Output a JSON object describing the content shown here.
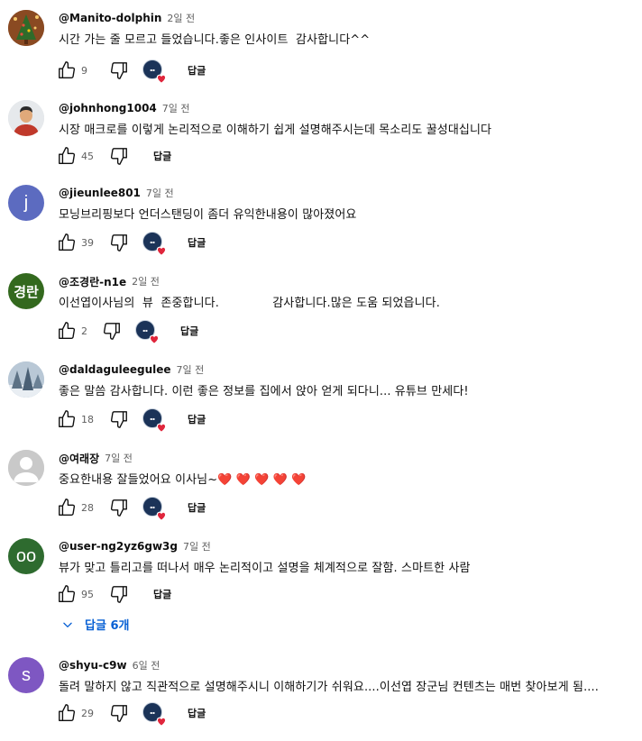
{
  "comments": [
    {
      "author": "@Manito-dolphin",
      "time": "2일 전",
      "text": "시간 가는 줄 모르고 들었습니다.좋은 인사이트  감사합니다^^",
      "likes": "9",
      "reply_label": "답글",
      "avatar_icon": "christmas-tree-photo",
      "creator_heart": true
    },
    {
      "author": "@johnhong1004",
      "time": "7일 전",
      "text": "시장 매크로를 이렇게 논리적으로 이해하기 쉽게 설명해주시는데 목소리도 꿀성대십니다",
      "likes": "45",
      "reply_label": "답글",
      "avatar_icon": "person-photo",
      "creator_heart": false
    },
    {
      "author": "@jieunlee801",
      "time": "7일 전",
      "text": "모닝브리핑보다 언더스탠딩이 좀더 유익한내용이 많아졌어요",
      "likes": "39",
      "reply_label": "답글",
      "avatar_letter": "j",
      "avatar_color": "#5c6bc0",
      "creator_heart": true
    },
    {
      "author": "@조경란-n1e",
      "time": "2일 전",
      "text": "이선엽이사님의  뷰  존중합니다.              감사합니다.많은 도움 되었읍니다.",
      "likes": "2",
      "reply_label": "답글",
      "avatar_letter": "경란",
      "avatar_color": "#33691e",
      "creator_heart": true
    },
    {
      "author": "@daldaguleegulee",
      "time": "7일 전",
      "text": "좋은 말씀 감사합니다. 이런 좋은 정보를 집에서 앉아 얻게 되다니... 유튜브 만세다!",
      "likes": "18",
      "reply_label": "답글",
      "avatar_icon": "winter-tree-photo",
      "creator_heart": true
    },
    {
      "author": "@여래장",
      "time": "7일 전",
      "text": "중요한내용 잘들었어요 이사님~",
      "hearts": "❤️ ❤️ ❤️ ❤️ ❤️",
      "likes": "28",
      "reply_label": "답글",
      "avatar_icon": "default-person-icon",
      "creator_heart": true
    },
    {
      "author": "@user-ng2yz6gw3g",
      "time": "7일 전",
      "text": "뷰가 맞고 틀리고를 떠나서 매우 논리적이고 설명을 체계적으로 잘함. 스마트한 사람",
      "likes": "95",
      "reply_label": "답글",
      "avatar_letter": "oo",
      "avatar_color": "#2e6b2f",
      "creator_heart": false
    },
    {
      "author": "@shyu-c9w",
      "time": "6일 전",
      "text": "돌려 말하지 않고 직관적으로 설명해주시니 이해하기가 쉬워요....이선엽 장군님 컨텐츠는 매번 찾아보게 됨....",
      "likes": "29",
      "reply_label": "답글",
      "avatar_letter": "s",
      "avatar_color": "#7e57c2",
      "creator_heart": true
    }
  ],
  "replies_toggle": {
    "label": "답글 6개",
    "icon": "chevron-down-icon"
  },
  "colors": {
    "link": "#065fd4",
    "muted": "#606060",
    "heart": "#e0263c"
  }
}
